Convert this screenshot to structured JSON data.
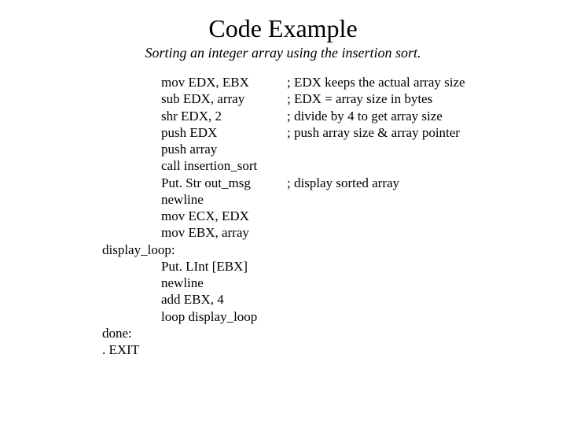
{
  "title": "Code Example",
  "subtitle": "Sorting an integer array using the insertion sort.",
  "lines": [
    {
      "label": "",
      "instr": "mov EDX, EBX",
      "comment": "; EDX keeps the actual array size"
    },
    {
      "label": "",
      "instr": "sub EDX, array",
      "comment": "; EDX = array size in bytes"
    },
    {
      "label": "",
      "instr": "shr EDX, 2",
      "comment": "; divide by 4 to get array size"
    },
    {
      "label": "",
      "instr": "push EDX",
      "comment": "; push array size & array pointer"
    },
    {
      "label": "",
      "instr": "push array",
      "comment": ""
    },
    {
      "label": "",
      "instr": "call insertion_sort",
      "comment": ""
    },
    {
      "label": "",
      "instr": "Put. Str out_msg",
      "comment": "; display sorted array"
    },
    {
      "label": "",
      "instr": "newline",
      "comment": ""
    },
    {
      "label": "",
      "instr": "mov ECX, EDX",
      "comment": ""
    },
    {
      "label": "",
      "instr": "mov EBX, array",
      "comment": ""
    },
    {
      "label": "display_loop:",
      "instr": "",
      "comment": ""
    },
    {
      "label": "",
      "instr": "Put. LInt [EBX]",
      "comment": ""
    },
    {
      "label": "",
      "instr": "newline",
      "comment": ""
    },
    {
      "label": "",
      "instr": "add EBX, 4",
      "comment": ""
    },
    {
      "label": "",
      "instr": "loop display_loop",
      "comment": ""
    },
    {
      "label": "done:",
      "instr": "",
      "comment": ""
    },
    {
      "label": ". EXIT",
      "instr": "",
      "comment": ""
    }
  ]
}
